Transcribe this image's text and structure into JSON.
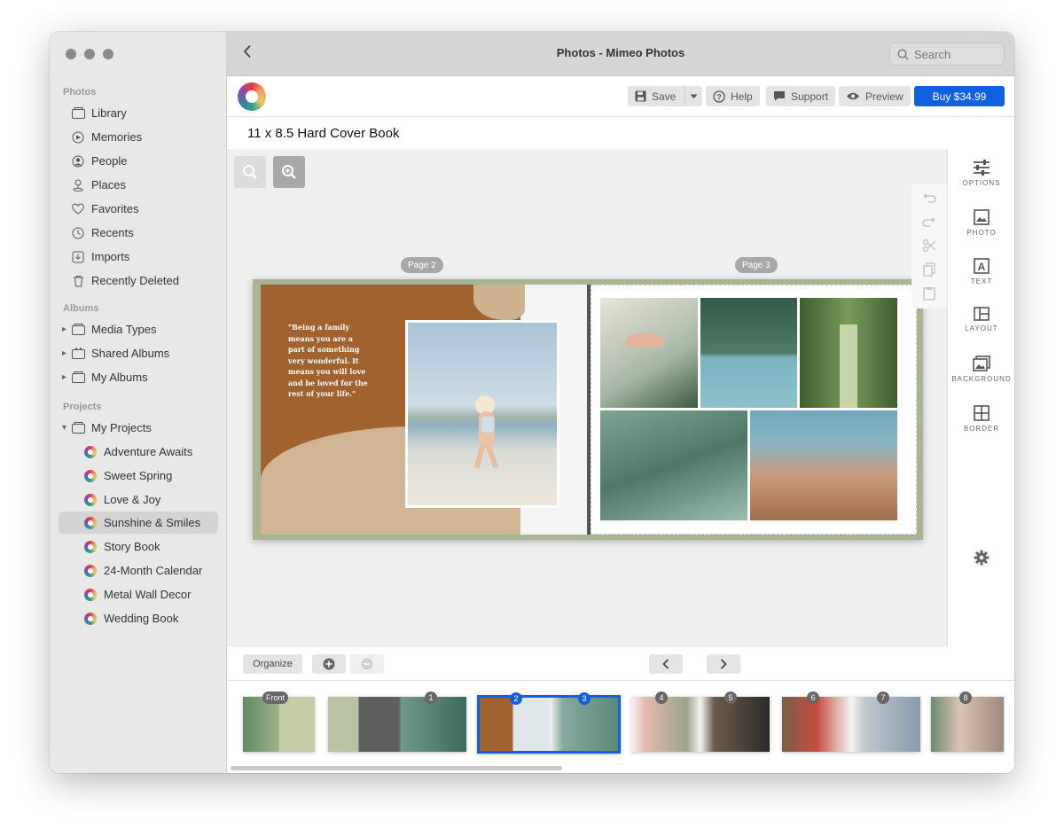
{
  "sidebar": {
    "sections": {
      "photos": "Photos",
      "albums": "Albums",
      "projects": "Projects"
    },
    "photos_items": [
      {
        "label": "Library",
        "icon": "library-icon"
      },
      {
        "label": "Memories",
        "icon": "memories-icon"
      },
      {
        "label": "People",
        "icon": "people-icon"
      },
      {
        "label": "Places",
        "icon": "places-icon"
      },
      {
        "label": "Favorites",
        "icon": "heart-icon"
      },
      {
        "label": "Recents",
        "icon": "clock-icon"
      },
      {
        "label": "Imports",
        "icon": "import-icon"
      },
      {
        "label": "Recently Deleted",
        "icon": "trash-icon"
      }
    ],
    "album_items": [
      {
        "label": "Media Types"
      },
      {
        "label": "Shared Albums"
      },
      {
        "label": "My Albums"
      }
    ],
    "projects_root": "My Projects",
    "project_items": [
      {
        "label": "Adventure Awaits"
      },
      {
        "label": "Sweet Spring"
      },
      {
        "label": "Love & Joy"
      },
      {
        "label": "Sunshine & Smiles",
        "selected": true
      },
      {
        "label": "Story Book"
      },
      {
        "label": "24-Month Calendar"
      },
      {
        "label": "Metal Wall Decor"
      },
      {
        "label": "Wedding Book"
      }
    ]
  },
  "titlebar": {
    "title": "Photos - Mimeo Photos",
    "search_placeholder": "Search"
  },
  "toolbar": {
    "save": "Save",
    "help": "Help",
    "support": "Support",
    "preview": "Preview",
    "buy": "Buy $34.99"
  },
  "project": {
    "title": "11 x 8.5 Hard Cover Book"
  },
  "spread": {
    "left_tag": "Page 2",
    "right_tag": "Page 3",
    "quote": "\"Being a family means you are a part of something very wonderful. It means you will love and be loved for the rest of your life.\""
  },
  "right_panel": [
    {
      "label": "OPTIONS",
      "icon": "options-sliders-icon"
    },
    {
      "label": "PHOTO",
      "icon": "photo-icon"
    },
    {
      "label": "TEXT",
      "icon": "text-icon"
    },
    {
      "label": "LAYOUT",
      "icon": "layout-icon"
    },
    {
      "label": "BACKGROUND",
      "icon": "background-icon"
    },
    {
      "label": "BORDER",
      "icon": "border-icon"
    }
  ],
  "bottombar": {
    "organize": "Organize"
  },
  "thumbnails": [
    {
      "badges": [
        "Front"
      ]
    },
    {
      "badges": [
        "1"
      ]
    },
    {
      "badges": [
        "2",
        "3"
      ],
      "selected": true
    },
    {
      "badges": [
        "4",
        "5"
      ]
    },
    {
      "badges": [
        "6",
        "7"
      ]
    },
    {
      "badges": [
        "8"
      ]
    }
  ],
  "colors": {
    "accent": "#1060e0",
    "sidebar_bg": "#e8e8e8",
    "selected_bg": "#d4d4d4"
  }
}
